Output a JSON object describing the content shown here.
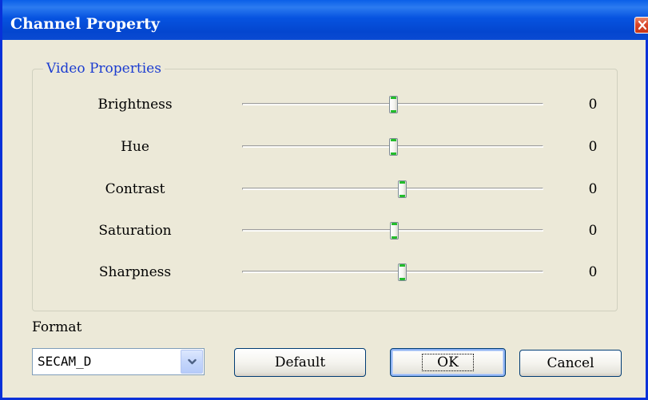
{
  "window": {
    "title": "Channel Property",
    "close_icon": "close-icon"
  },
  "video_properties": {
    "legend": "Video Properties",
    "range": [
      -100,
      100
    ],
    "rows": [
      {
        "label": "Brightness",
        "value": "0",
        "slider_level": 0.5
      },
      {
        "label": "Hue",
        "value": "0",
        "slider_level": 0.5
      },
      {
        "label": "Contrast",
        "value": "0",
        "slider_level": 0.53
      },
      {
        "label": "Saturation",
        "value": "0",
        "slider_level": 0.505
      },
      {
        "label": "Sharpness",
        "value": "0",
        "slider_level": 0.53
      }
    ]
  },
  "format": {
    "label": "Format",
    "selected": "SECAM_D",
    "dropdown_icon": "chevron-down-icon"
  },
  "buttons": {
    "default": "Default",
    "ok": "OK",
    "cancel": "Cancel"
  },
  "colors": {
    "title_bar": "#0653e0",
    "group_legend": "#1b3cd0",
    "slider_thumb_accent": "#23bc2b",
    "close_button": "#d9462a"
  }
}
